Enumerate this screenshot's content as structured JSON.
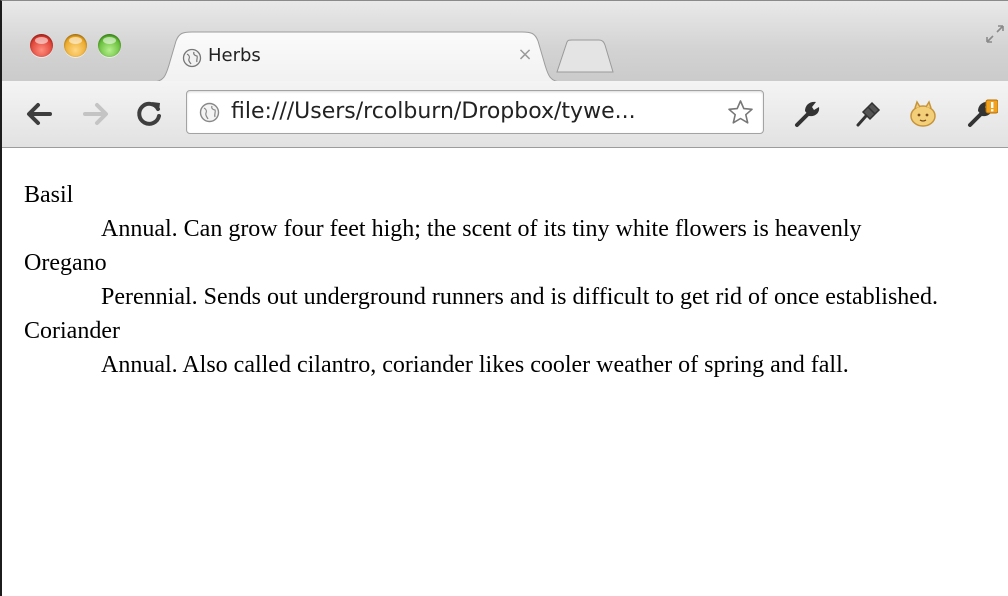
{
  "browser": {
    "tab": {
      "title": "Herbs",
      "close_glyph": "×"
    },
    "omnibox": {
      "url": "file:///Users/rcolburn/Dropbox/tywe..."
    },
    "icons": {
      "back": "back-arrow-icon",
      "forward": "forward-arrow-icon",
      "reload": "reload-icon",
      "globe": "globe-icon",
      "star": "bookmark-star-icon",
      "wrench": "wrench-icon",
      "pin": "pin-icon",
      "cookie": "cookie-extension-icon",
      "menu": "wrench-menu-icon",
      "fullscreen": "fullscreen-icon"
    },
    "colors": {
      "close": "#d8352a",
      "minimize": "#e8a21c",
      "maximize": "#58b52b"
    }
  },
  "page": {
    "herbs": [
      {
        "name": "Basil",
        "description": "Annual. Can grow four feet high; the scent of its tiny white flowers is heavenly"
      },
      {
        "name": "Oregano",
        "description": "Perennial. Sends out underground runners and is difficult to get rid of once established."
      },
      {
        "name": "Coriander",
        "description": "Annual. Also called cilantro, coriander likes cooler weather of spring and fall."
      }
    ]
  }
}
